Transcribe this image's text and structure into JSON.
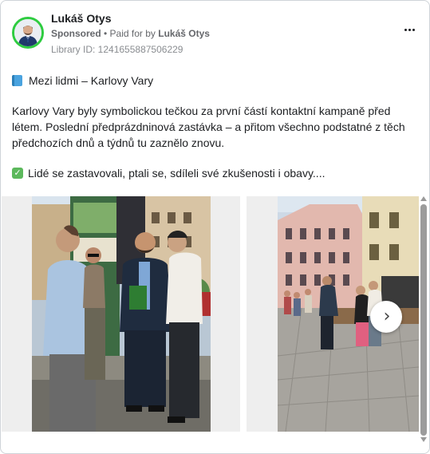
{
  "post": {
    "author_name": "Lukáš Otys",
    "sponsored_label": "Sponsored",
    "separator": " • ",
    "paid_for_prefix": "Paid for by ",
    "paid_for_name": "Lukáš Otys",
    "library_id": "Library ID: 1241655887506229",
    "more_icon": "more-horizontal-icon"
  },
  "content": {
    "heading": "Mezi lidmi – Karlovy Vary",
    "heading_icon": "book-emoji-icon",
    "paragraph": "Karlovy Vary byly symbolickou tečkou za první částí kontaktní kampaně před létem. Poslední předprázdninová zastávka – a přitom všechno podstatné z těch předchozích dnů a týdnů tu zaznělo znovu.",
    "bullet": "Lidé se zastavovali, ptali se, sdíleli své zkušenosti i obavy....",
    "bullet_icon": "check-mark-emoji-icon",
    "bullet_icon_glyph": "✓"
  },
  "carousel": {
    "next_icon": "chevron-right-icon",
    "next_glyph": "›",
    "slides": [
      "street-conversation-photo",
      "town-square-photo"
    ]
  },
  "colors": {
    "avatar_ring": "#2ecc40",
    "text": "#1c1e21",
    "muted": "#65676b"
  }
}
